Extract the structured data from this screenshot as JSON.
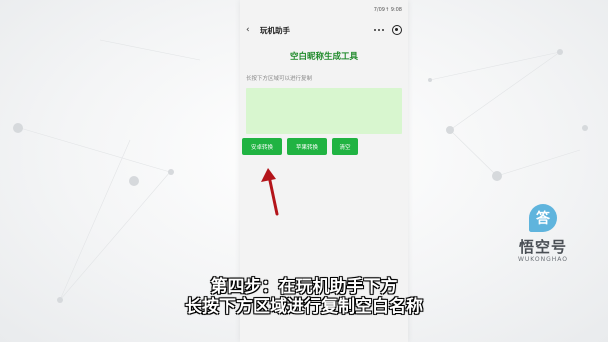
{
  "status_bar": {
    "text": "7/09↑ 9:08"
  },
  "nav": {
    "back_icon": "‹",
    "title": "玩机助手"
  },
  "page": {
    "heading": "空白昵称生成工具",
    "hint": "长按下方区域可以进行复制",
    "copy_area_value": ""
  },
  "buttons": {
    "android": "安卓转换",
    "apple": "苹果转换",
    "clear": "清空"
  },
  "logo": {
    "bubble": "答",
    "name": "悟空号",
    "sub": "WUKONGHAO"
  },
  "captions": {
    "line1": "第四步：在玩机助手下方",
    "line2": "长按下方区域进行复制空白名称"
  },
  "colors": {
    "accent_green": "#20b342",
    "heading_green": "#1f8a2a",
    "copy_area_bg": "#d8f6cf",
    "logo_blue": "#5fb4dd",
    "arrow": "#b3141a"
  }
}
